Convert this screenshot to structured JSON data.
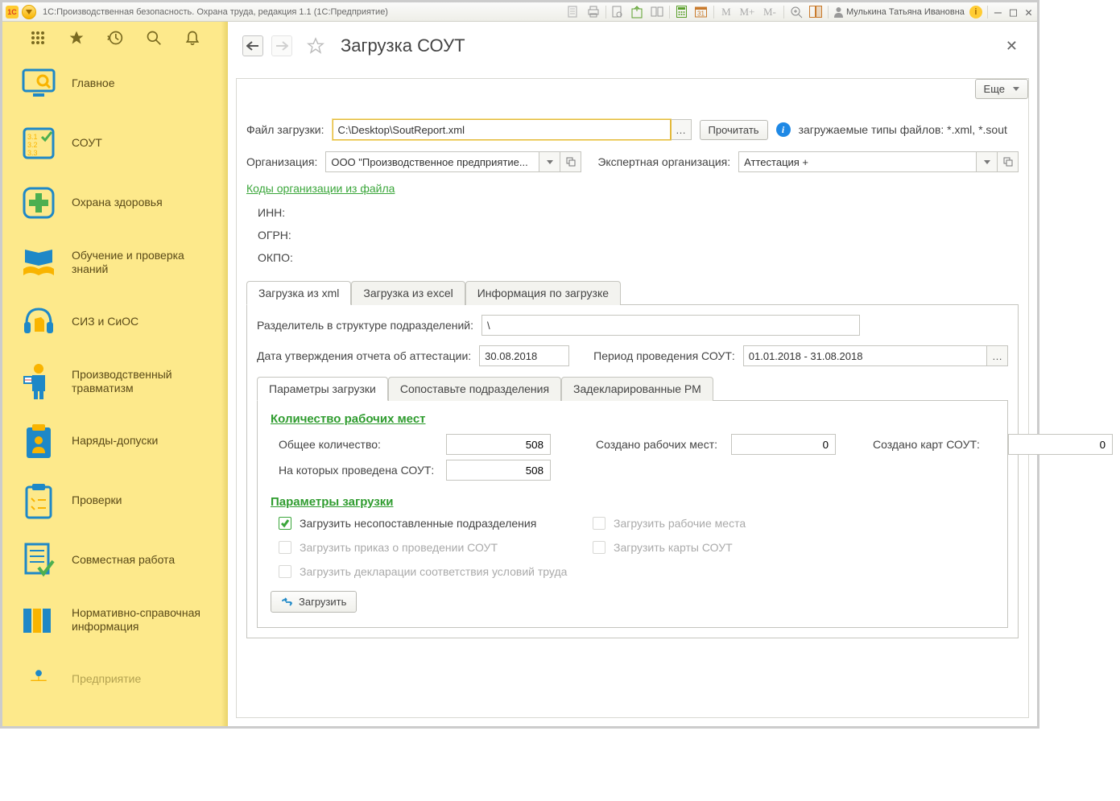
{
  "titlebar": {
    "app_title": "1С:Производственная безопасность. Охрана труда, редакция 1.1  (1С:Предприятие)",
    "user_name": "Мулькина Татьяна Ивановна",
    "m_labels": [
      "M",
      "M+",
      "M-"
    ]
  },
  "sidebar": {
    "items": [
      {
        "label": "Главное"
      },
      {
        "label": "СОУТ"
      },
      {
        "label": "Охрана здоровья"
      },
      {
        "label": "Обучение и проверка знаний"
      },
      {
        "label": "СИЗ и СиОС"
      },
      {
        "label": "Производственный травматизм"
      },
      {
        "label": "Наряды-допуски"
      },
      {
        "label": "Проверки"
      },
      {
        "label": "Совместная работа"
      },
      {
        "label": "Нормативно-справочная информация"
      },
      {
        "label": "Предприятие"
      }
    ]
  },
  "page": {
    "title": "Загрузка СОУТ",
    "more_btn": "Еще",
    "file_label": "Файл загрузки:",
    "file_value": "C:\\Desktop\\SoutReport.xml",
    "read_btn": "Прочитать",
    "hint": "загружаемые типы файлов: *.xml, *.sout",
    "org_label": "Организация:",
    "org_value": "ООО \"Производственное предприятие...",
    "exp_label": "Экспертная организация:",
    "exp_value": "Аттестация +",
    "codes_link": "Коды организации из файла",
    "codes": {
      "inn": "ИНН:",
      "ogrn": "ОГРН:",
      "okpo": "ОКПО:"
    },
    "tabs": [
      "Загрузка из xml",
      "Загрузка из excel",
      "Информация по загрузке"
    ],
    "xml": {
      "delim_label": "Разделитель в структуре подразделений:",
      "delim_value": "\\",
      "date_label": "Дата утверждения отчета об аттестации:",
      "date_value": "30.08.2018",
      "period_label": "Период проведения СОУТ:",
      "period_value": "01.01.2018 - 31.08.2018",
      "sub_tabs": [
        "Параметры загрузки",
        "Сопоставьте подразделения",
        "Задекларированные РМ"
      ],
      "counts_title": "Количество рабочих мест",
      "total_label": "Общее количество:",
      "total_value": "508",
      "done_label": "На которых проведена СОУТ:",
      "done_value": "508",
      "created_rm_label": "Создано рабочих мест:",
      "created_rm_value": "0",
      "created_cards_label": "Создано карт СОУТ:",
      "created_cards_value": "0",
      "params_title": "Параметры загрузки",
      "chk_unmapped": "Загрузить несопоставленные подразделения",
      "chk_order": "Загрузить приказ о проведении СОУТ",
      "chk_decl": "Загрузить декларации соответствия условий труда",
      "chk_rm": "Загрузить рабочие места",
      "chk_cards": "Загрузить карты СОУТ",
      "load_btn": "Загрузить"
    }
  }
}
